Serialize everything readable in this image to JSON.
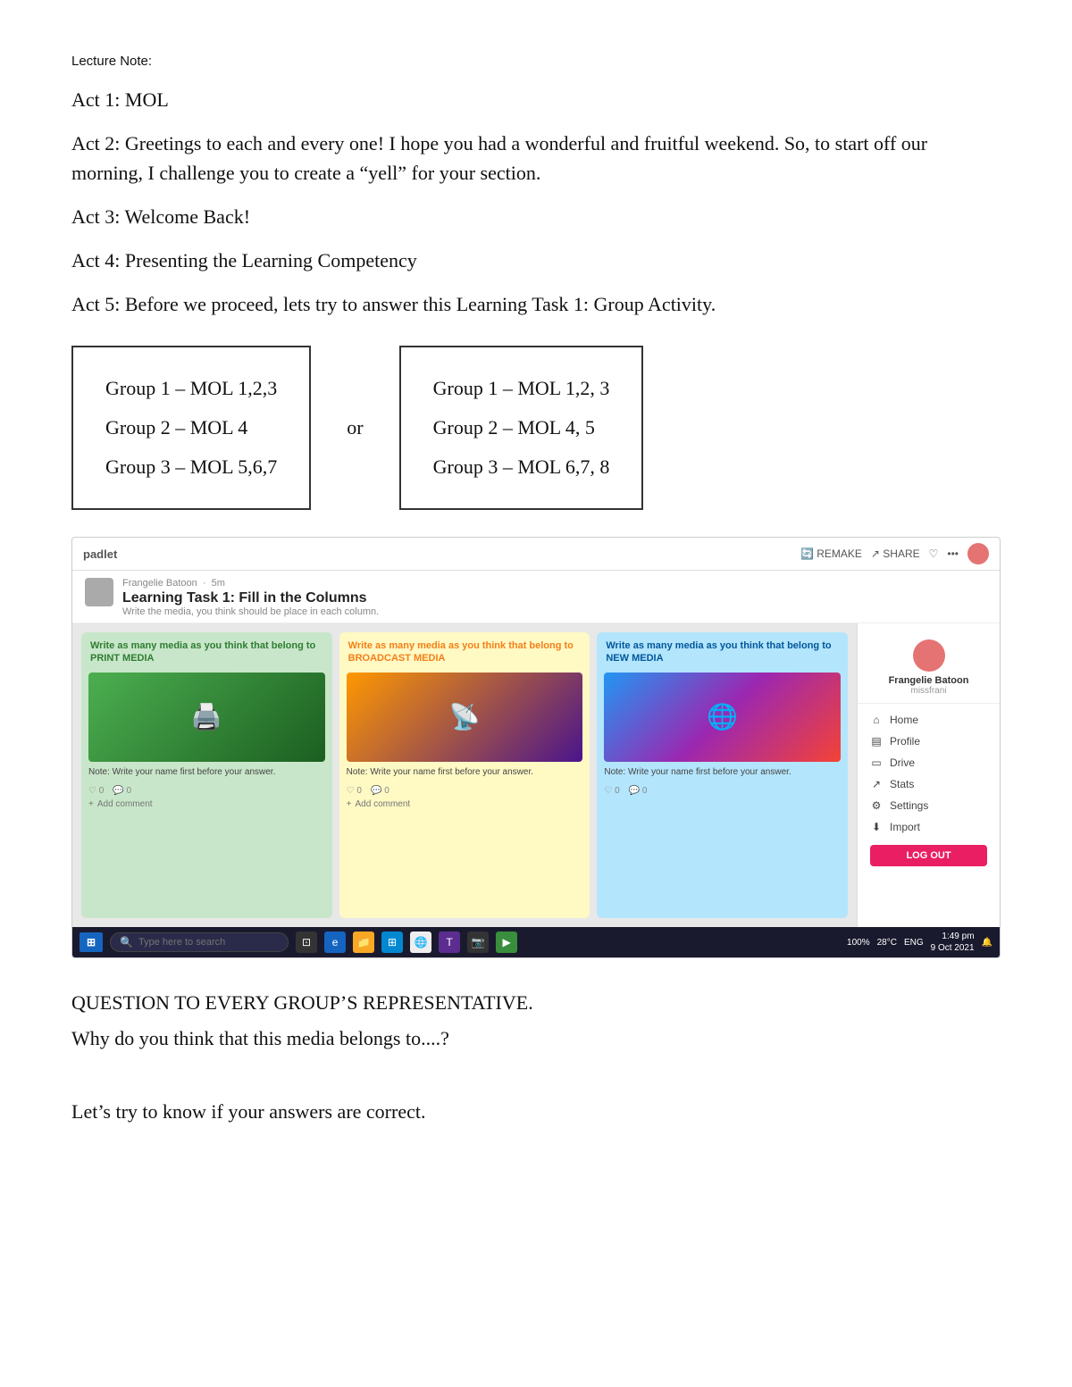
{
  "lecture_note_label": "Lecture Note:",
  "acts": [
    {
      "id": "act1",
      "text": "Act 1:  MOL"
    },
    {
      "id": "act2",
      "text": "Act 2: Greetings to each and every one! I hope you had a wonderful and fruitful weekend. So, to start off our morning, I challenge you to create a “yell” for your section."
    },
    {
      "id": "act3",
      "text": "Act 3: Welcome Back!"
    },
    {
      "id": "act4",
      "text": "Act 4: Presenting the Learning Competency"
    },
    {
      "id": "act5",
      "text": "Act 5: Before we proceed, lets try to answer this Learning Task 1: Group Activity."
    }
  ],
  "group_box_left": {
    "line1": "Group 1 – MOL 1,2,3",
    "line2": "Group 2 – MOL 4",
    "line3": "Group 3 – MOL 5,6,7"
  },
  "or_label": "or",
  "group_box_right": {
    "line1": "Group 1 – MOL 1,2, 3",
    "line2": "Group 2 – MOL 4, 5",
    "line3": "Group 3 – MOL 6,7, 8"
  },
  "padlet": {
    "brand": "padlet",
    "user": "Frangelie Batoon",
    "time_ago": "5m",
    "title": "Learning Task 1: Fill in the Columns",
    "subtitle": "Write the media, you think should be place in each column.",
    "topbar_right": [
      "REMAKE",
      "SHARE",
      "★",
      "..."
    ],
    "sidebar_user": "Frangelie Batoon",
    "sidebar_role": "missfrani",
    "menu_items": [
      {
        "icon": "⌂",
        "label": "Home"
      },
      {
        "icon": "▤",
        "label": "Profile"
      },
      {
        "icon": "□",
        "label": "Drive"
      },
      {
        "icon": "↗",
        "label": "Stats"
      },
      {
        "icon": "⚙",
        "label": "Settings"
      },
      {
        "icon": "⤓",
        "label": "Import"
      }
    ],
    "logout_label": "LOG OUT",
    "columns": [
      {
        "id": "print",
        "color": "green",
        "header": "Write as many media as you think that belong to PRINT MEDIA",
        "img_label": "PRINT",
        "note": "Note: Write your name first before your answer.",
        "likes": "0",
        "comments": "0",
        "add_comment": "Add comment"
      },
      {
        "id": "broadcast",
        "color": "yellow",
        "header": "Write as many media as you think that belong to BROADCAST MEDIA",
        "img_label": "📡",
        "note": "Note: Write your name first before your answer.",
        "likes": "0",
        "comments": "0",
        "add_comment": "Add comment"
      },
      {
        "id": "new",
        "color": "blue",
        "header": "Write as many media as you think that belong to NEW MEDIA",
        "img_label": "🌐",
        "note": "Note: Write your name first before your answer.",
        "likes": "0",
        "comments": "0",
        "add_comment": "Add comment"
      }
    ]
  },
  "taskbar": {
    "search_placeholder": "Type here to search",
    "time": "1:49 pm",
    "date": "9 Oct 2021",
    "battery": "100%",
    "temp": "28°C",
    "lang": "ENG"
  },
  "questions": [
    "QUESTION TO EVERY GROUP’S REPRESENTATIVE.",
    "Why do you think that this media belongs to....?"
  ],
  "let_try": "Let’s try to know if your answers are correct."
}
